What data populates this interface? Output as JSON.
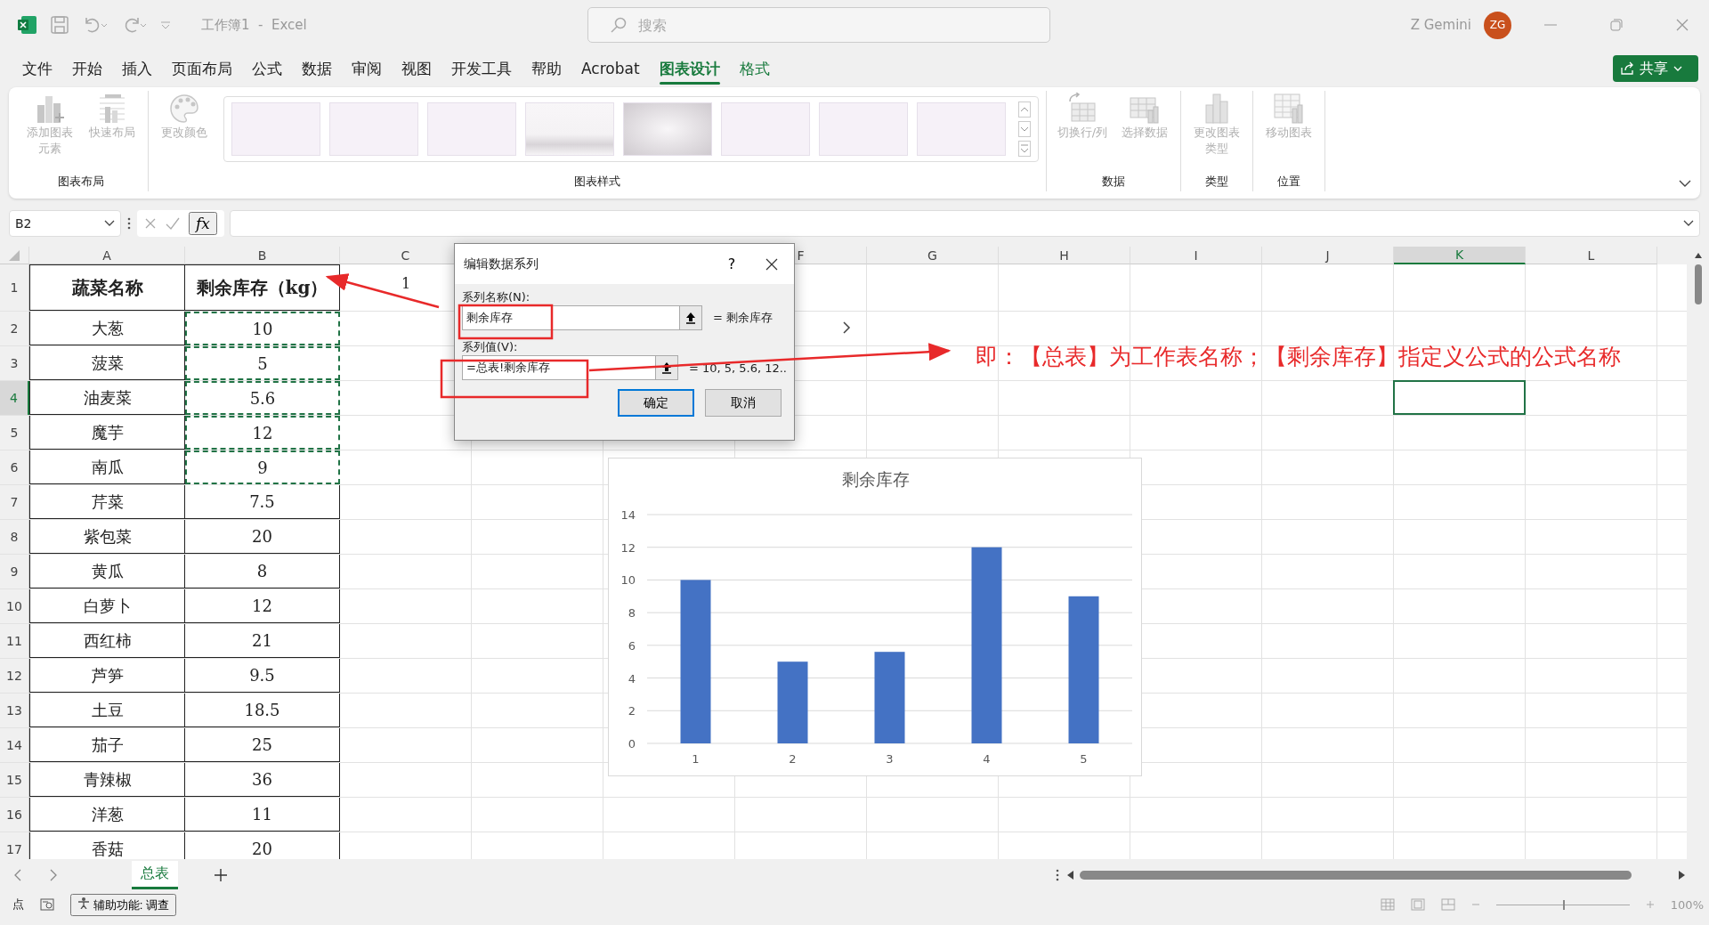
{
  "title_bar": {
    "title": "工作簿1  -  Excel",
    "search": {
      "placeholder": "搜索"
    },
    "user": "Z Gemini",
    "avatar": "ZG"
  },
  "menu_tabs": [
    {
      "label": "文件",
      "selected": false,
      "contextual": false
    },
    {
      "label": "开始",
      "selected": false,
      "contextual": false
    },
    {
      "label": "插入",
      "selected": false,
      "contextual": false
    },
    {
      "label": "页面布局",
      "selected": false,
      "contextual": false
    },
    {
      "label": "公式",
      "selected": false,
      "contextual": false
    },
    {
      "label": "数据",
      "selected": false,
      "contextual": false
    },
    {
      "label": "审阅",
      "selected": false,
      "contextual": false
    },
    {
      "label": "视图",
      "selected": false,
      "contextual": false
    },
    {
      "label": "开发工具",
      "selected": false,
      "contextual": false
    },
    {
      "label": "帮助",
      "selected": false,
      "contextual": false
    },
    {
      "label": "Acrobat",
      "selected": false,
      "contextual": false
    },
    {
      "label": "图表设计",
      "selected": true,
      "contextual": true
    },
    {
      "label": "格式",
      "selected": false,
      "contextual": true
    }
  ],
  "share_button": "共享",
  "ribbon": {
    "groups": [
      {
        "label": "图表布局",
        "commands": [
          {
            "label": "添加图表元素",
            "kind": "elements",
            "disabled": true
          },
          {
            "label": "快速布局",
            "kind": "layout",
            "disabled": true
          }
        ]
      },
      {
        "label": "图表样式",
        "commands": [
          {
            "label": "更改颜色",
            "kind": "palette",
            "disabled": true
          }
        ],
        "gallery": [
          {
            "kind": "flat"
          },
          {
            "kind": "flat"
          },
          {
            "kind": "flat"
          },
          {
            "kind": "gloss"
          },
          {
            "kind": "shade"
          },
          {
            "kind": "flat"
          },
          {
            "kind": "flat"
          },
          {
            "kind": "flat"
          }
        ]
      },
      {
        "label": "数据",
        "commands": [
          {
            "label": "切换行/列",
            "kind": "switch",
            "disabled": true
          },
          {
            "label": "选择数据",
            "kind": "select",
            "disabled": true
          }
        ]
      },
      {
        "label": "类型",
        "commands": [
          {
            "label": "更改图表类型",
            "kind": "charttype",
            "disabled": true
          }
        ]
      },
      {
        "label": "位置",
        "commands": [
          {
            "label": "移动图表",
            "kind": "move",
            "disabled": true
          }
        ]
      }
    ]
  },
  "formula_bar": {
    "name_box": "B2",
    "function_label": "fx"
  },
  "columns": [
    {
      "label": "A",
      "selected": false
    },
    {
      "label": "B",
      "selected": false
    },
    {
      "label": "C",
      "selected": false
    },
    {
      "label": "F",
      "selected": false
    },
    {
      "label": "G",
      "selected": false
    },
    {
      "label": "H",
      "selected": false
    },
    {
      "label": "I",
      "selected": false
    },
    {
      "label": "J",
      "selected": false
    },
    {
      "label": "K",
      "selected": true
    },
    {
      "label": "L",
      "selected": false
    }
  ],
  "rows": [
    {
      "number": "1",
      "selected": false,
      "copy_marquee": false,
      "cells": [
        "蔬菜名称",
        "剩余库存（kg）",
        "1"
      ]
    },
    {
      "number": "2",
      "selected": false,
      "copy_marquee": true,
      "cells": [
        "大葱",
        "10"
      ]
    },
    {
      "number": "3",
      "selected": false,
      "copy_marquee": true,
      "cells": [
        "菠菜",
        "5"
      ]
    },
    {
      "number": "4",
      "selected": true,
      "copy_marquee": true,
      "cells": [
        "油麦菜",
        "5.6"
      ]
    },
    {
      "number": "5",
      "selected": false,
      "copy_marquee": true,
      "cells": [
        "魔芋",
        "12"
      ]
    },
    {
      "number": "6",
      "selected": false,
      "copy_marquee": true,
      "cells": [
        "南瓜",
        "9"
      ]
    },
    {
      "number": "7",
      "selected": false,
      "copy_marquee": false,
      "cells": [
        "芹菜",
        "7.5"
      ]
    },
    {
      "number": "8",
      "selected": false,
      "copy_marquee": false,
      "cells": [
        "紫包菜",
        "20"
      ]
    },
    {
      "number": "9",
      "selected": false,
      "copy_marquee": false,
      "cells": [
        "黄瓜",
        "8"
      ]
    },
    {
      "number": "10",
      "selected": false,
      "copy_marquee": false,
      "cells": [
        "白萝卜",
        "12"
      ]
    },
    {
      "number": "11",
      "selected": false,
      "copy_marquee": false,
      "cells": [
        "西红柿",
        "21"
      ]
    },
    {
      "number": "12",
      "selected": false,
      "copy_marquee": false,
      "cells": [
        "芦笋",
        "9.5"
      ]
    },
    {
      "number": "13",
      "selected": false,
      "copy_marquee": false,
      "cells": [
        "土豆",
        "18.5"
      ]
    },
    {
      "number": "14",
      "selected": false,
      "copy_marquee": false,
      "cells": [
        "茄子",
        "25"
      ]
    },
    {
      "number": "15",
      "selected": false,
      "copy_marquee": false,
      "cells": [
        "青辣椒",
        "36"
      ]
    },
    {
      "number": "16",
      "selected": false,
      "copy_marquee": false,
      "cells": [
        "洋葱",
        "11"
      ]
    },
    {
      "number": "17",
      "selected": false,
      "copy_marquee": false,
      "cells": [
        "香菇",
        "20"
      ]
    }
  ],
  "dialog": {
    "title": "编辑数据系列",
    "help": "?",
    "fields": [
      {
        "label": "系列名称(N):",
        "value": "剩余库存",
        "result": "= 剩余库存"
      },
      {
        "label": "系列值(V):",
        "value": "=总表!剩余库存",
        "result": "= 10, 5, 5.6, 12.."
      }
    ],
    "buttons": [
      {
        "label": "确定",
        "default": true
      },
      {
        "label": "取消",
        "default": false
      }
    ]
  },
  "chart": {
    "chart_data": {
      "type": "bar",
      "title": "剩余库存",
      "categories": [
        "1",
        "2",
        "3",
        "4",
        "5"
      ],
      "values": [
        10,
        5,
        5.6,
        12,
        9
      ],
      "grid": true,
      "ylim": [
        0,
        14
      ],
      "yticks": [
        0,
        2,
        4,
        6,
        8,
        10,
        12,
        14
      ]
    }
  },
  "annotation": "即：【总表】为工作表名称；【剩余库存】指定义公式的公式名称",
  "sheet_tabs": [
    {
      "label": "总表",
      "selected": true
    }
  ],
  "status_bar": {
    "mode": "点",
    "accessibility": "辅助功能: 调查",
    "zoom_slider": {
      "level": 0.5
    },
    "zoom": "100%"
  }
}
